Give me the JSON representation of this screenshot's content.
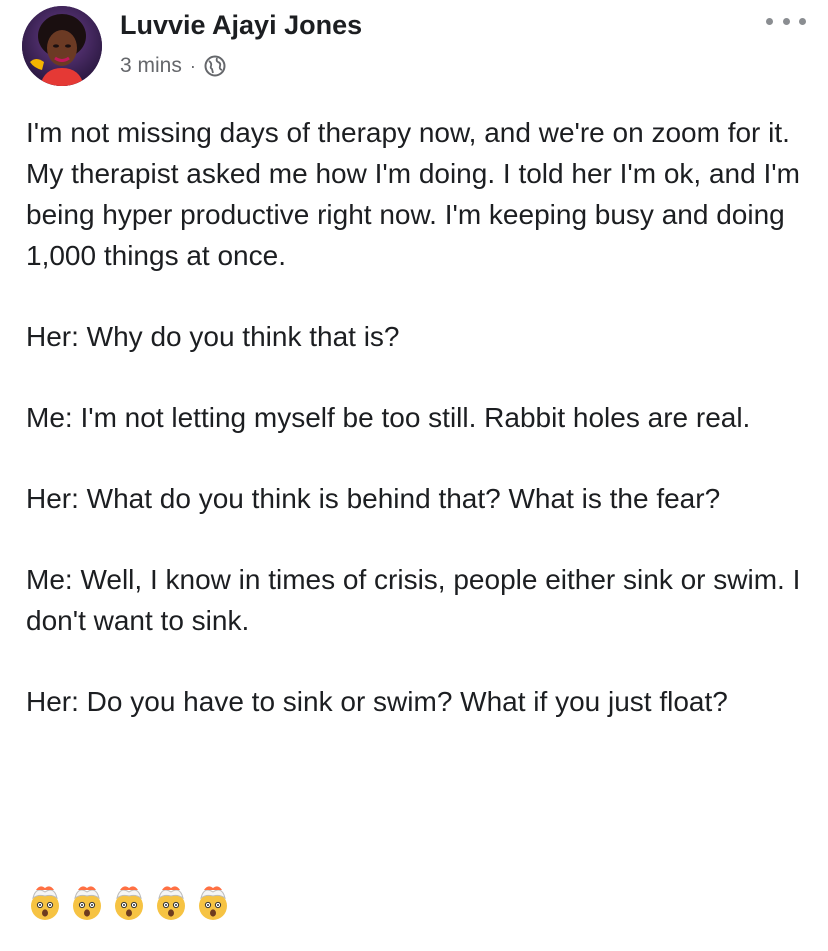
{
  "post": {
    "author_name": "Luvvie Ajayi Jones",
    "timestamp": "3 mins",
    "separator": "·",
    "audience_icon": "globe-icon",
    "more_icon": "more-options-icon",
    "paragraphs": [
      "I'm not missing days of therapy now, and we're on zoom for it. My therapist asked me how I'm doing. I told her I'm ok, and I'm being hyper productive right now. I'm keeping busy and doing 1,000 things at once.",
      "Her: Why do you think that is?",
      "Me: I'm not letting myself be too still. Rabbit holes are real.",
      "Her: What do you think is behind that? What is the fear?",
      "Me: Well, I know in times of crisis, people either sink or swim. I don't want to sink.",
      "Her: Do you have to sink or swim? What if you just float?"
    ],
    "emoji_reactions": [
      "exploding-head-emoji",
      "exploding-head-emoji",
      "exploding-head-emoji",
      "exploding-head-emoji",
      "exploding-head-emoji"
    ]
  },
  "colors": {
    "text_primary": "#1c1e21",
    "text_secondary": "#65676b",
    "icon_gray": "#8a8d91",
    "background": "#ffffff"
  }
}
